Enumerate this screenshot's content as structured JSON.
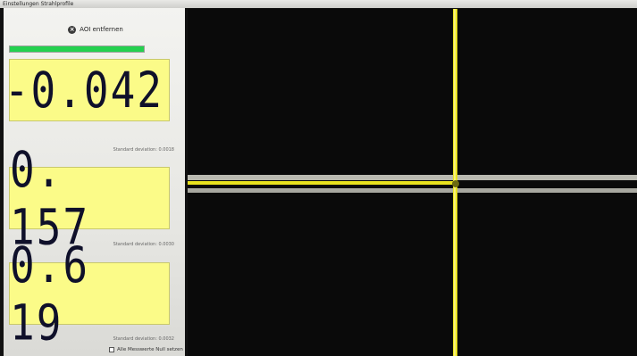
{
  "window": {
    "title": "Einstellungen   Strahlprofile"
  },
  "panel": {
    "aoi_button_label": "AOI entfernen",
    "progress_fraction": 1.0,
    "readouts": [
      {
        "value": "-0.042",
        "std_label": "Standard deviation: 0.0018"
      },
      {
        "value": "0. 157",
        "std_label": "Standard deviation: 0.0030"
      },
      {
        "value": "0.6 19",
        "std_label": "Standard deviation: 0.0032"
      }
    ],
    "checkbox_label": "Alle Messwerte Null setzen"
  },
  "colors": {
    "readout_bg": "#fbfb88",
    "crosshair": "#e8e21e",
    "progress": "#24d14f"
  }
}
